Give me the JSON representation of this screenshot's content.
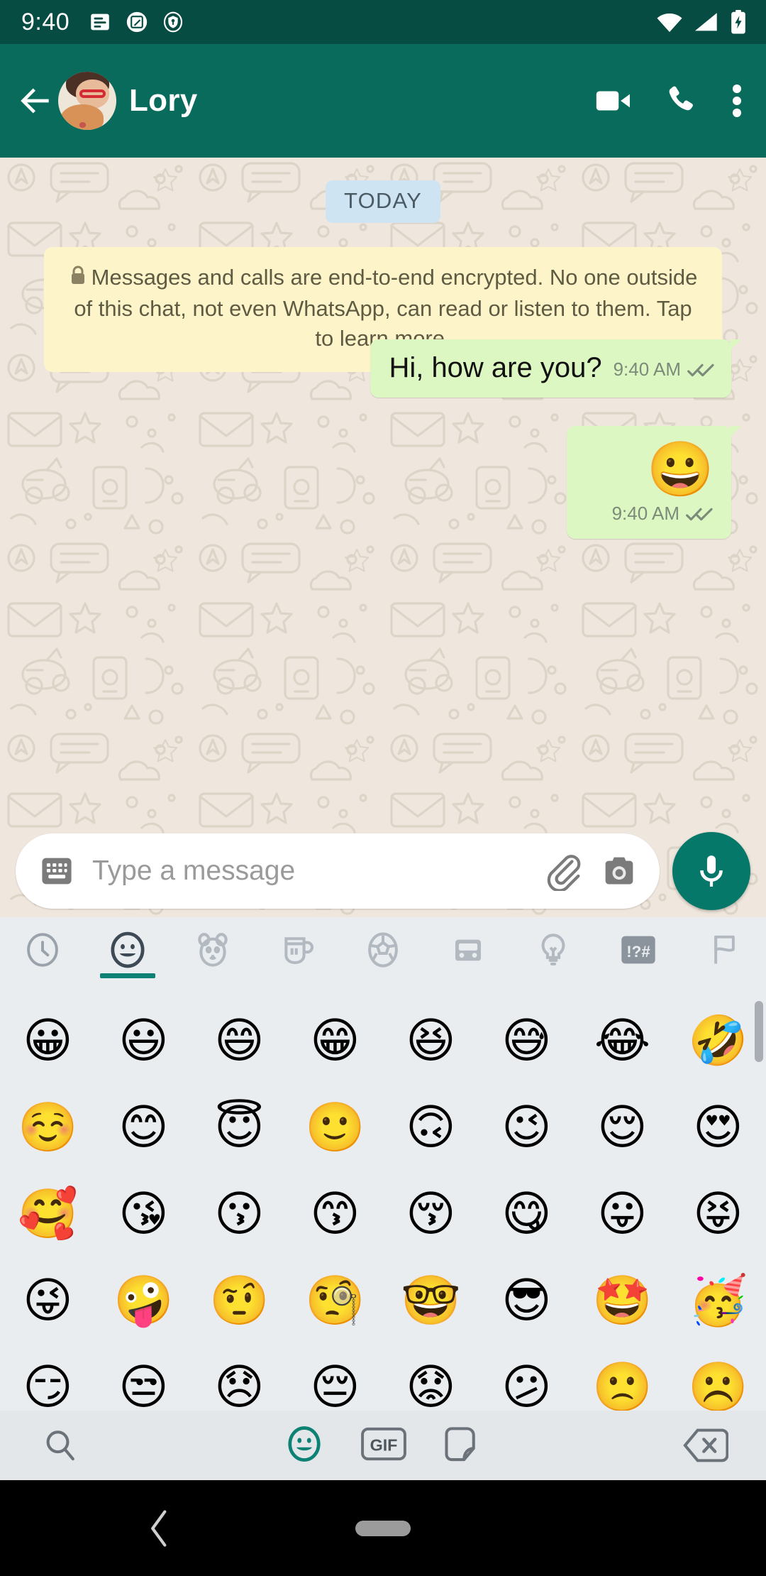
{
  "colors": {
    "status_bar": "#064c43",
    "app_bar": "#096b5b",
    "chat_background": "#efe7dd",
    "outgoing_bubble": "#ddf7c3",
    "date_badge": "#cfe4f2",
    "encryption_notice": "#fdf5c9",
    "accent_teal": "#0c8174",
    "mic_button": "#05786a",
    "emoji_panel": "#eaedf0",
    "emoji_toolbar": "#e3e7ea",
    "nav_bar": "#000000"
  },
  "status_bar": {
    "time": "9:40",
    "left_icons": [
      "notes-notification-icon",
      "screenshot-edit-icon",
      "vpn-key-shield-icon"
    ],
    "right_icons": [
      "wifi-icon",
      "cellular-signal-icon",
      "battery-charging-icon"
    ]
  },
  "app_bar": {
    "back_label": "back-arrow-icon",
    "contact_name": "Lory",
    "avatar_label": "contact-avatar",
    "actions": [
      {
        "name": "video-call-icon",
        "label": "Video call"
      },
      {
        "name": "voice-call-icon",
        "label": "Voice call"
      },
      {
        "name": "more-options-icon",
        "label": "More options"
      }
    ]
  },
  "chat": {
    "date_divider": "TODAY",
    "encryption_notice": "Messages and calls are end-to-end encrypted. No one outside of this chat, not even WhatsApp, can read or listen to them. Tap to learn more.",
    "messages": [
      {
        "type": "text",
        "direction": "outgoing",
        "text": "Hi, how are you?",
        "time": "9:40 AM",
        "status": "read-double-check"
      },
      {
        "type": "emoji",
        "direction": "outgoing",
        "text": "😀",
        "time": "9:40 AM",
        "status": "read-double-check"
      }
    ]
  },
  "input_bar": {
    "keyboard_icon": "keyboard-icon",
    "placeholder": "Type a message",
    "value": "",
    "attach_icon": "paperclip-attach-icon",
    "camera_icon": "camera-icon",
    "mic_icon": "microphone-icon"
  },
  "emoji_panel": {
    "categories": [
      {
        "name": "recent",
        "icon": "clock-icon",
        "active": false
      },
      {
        "name": "smileys",
        "icon": "smiley-icon",
        "active": true
      },
      {
        "name": "animals",
        "icon": "animal-bear-icon",
        "active": false
      },
      {
        "name": "food",
        "icon": "coffee-cup-icon",
        "active": false
      },
      {
        "name": "activity",
        "icon": "soccer-ball-icon",
        "active": false
      },
      {
        "name": "travel",
        "icon": "car-icon",
        "active": false
      },
      {
        "name": "objects",
        "icon": "lightbulb-icon",
        "active": false
      },
      {
        "name": "symbols",
        "icon": "symbols-icon",
        "label": "!?#",
        "active": false
      },
      {
        "name": "flags",
        "icon": "flag-icon",
        "active": false
      }
    ],
    "rows": [
      [
        "😀",
        "😃",
        "😄",
        "😁",
        "😆",
        "😅",
        "😂",
        "🤣"
      ],
      [
        "☺️",
        "😊",
        "😇",
        "🙂",
        "🙃",
        "😉",
        "😌",
        "😍"
      ],
      [
        "🥰",
        "😘",
        "😗",
        "😙",
        "😚",
        "😋",
        "😛",
        "😝"
      ],
      [
        "😜",
        "🤪",
        "🤨",
        "🧐",
        "🤓",
        "😎",
        "🤩",
        "🥳"
      ],
      [
        "😏",
        "😒",
        "😞",
        "😔",
        "😟",
        "😕",
        "🙁",
        "☹️"
      ]
    ]
  },
  "emoji_toolbar": {
    "search_icon": "search-icon",
    "emoji_tab_icon": "smiley-icon",
    "gif_label": "GIF",
    "sticker_icon": "sticker-icon",
    "backspace_icon": "backspace-delete-icon"
  },
  "nav_bar": {
    "back_icon": "nav-back-chevron-icon",
    "home_pill": "nav-home-pill"
  }
}
